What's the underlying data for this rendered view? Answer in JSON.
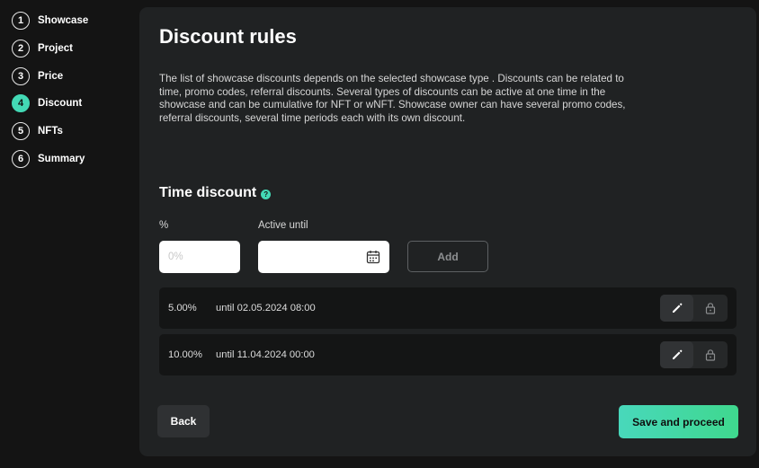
{
  "steps": [
    {
      "num": "1",
      "label": "Showcase"
    },
    {
      "num": "2",
      "label": "Project"
    },
    {
      "num": "3",
      "label": "Price"
    },
    {
      "num": "4",
      "label": "Discount"
    },
    {
      "num": "5",
      "label": "NFTs"
    },
    {
      "num": "6",
      "label": "Summary"
    }
  ],
  "active_step": "4",
  "page": {
    "title": "Discount rules",
    "description": "The list of  showcase discounts depends on  the selected showcase type . Discounts can be  related to time, promo codes, referral discounts. Several types of  discounts can be  active at  one time in  the showcase and can be  cumulative for NFT or  wNFT. Showcase owner can have several promo codes, referral discounts, several time periods each with its own discount."
  },
  "time_discount": {
    "title": "Time discount",
    "help_icon": "question-icon",
    "percent_label": "%",
    "percent_placeholder": "0%",
    "active_until_label": "Active until",
    "active_until_value": "",
    "calendar_icon": "calendar-icon",
    "add_label": "Add"
  },
  "discounts": [
    {
      "percent": "5.00%",
      "until": "until 02.05.2024 08:00"
    },
    {
      "percent": "10.00%",
      "until": "until 11.04.2024 00:00"
    }
  ],
  "row_icons": {
    "edit": "pencil-icon",
    "lock": "lock-icon"
  },
  "buttons": {
    "back": "Back",
    "save": "Save and proceed"
  },
  "colors": {
    "accent": "#43d9b5",
    "panel": "#202223",
    "background": "#141414"
  }
}
